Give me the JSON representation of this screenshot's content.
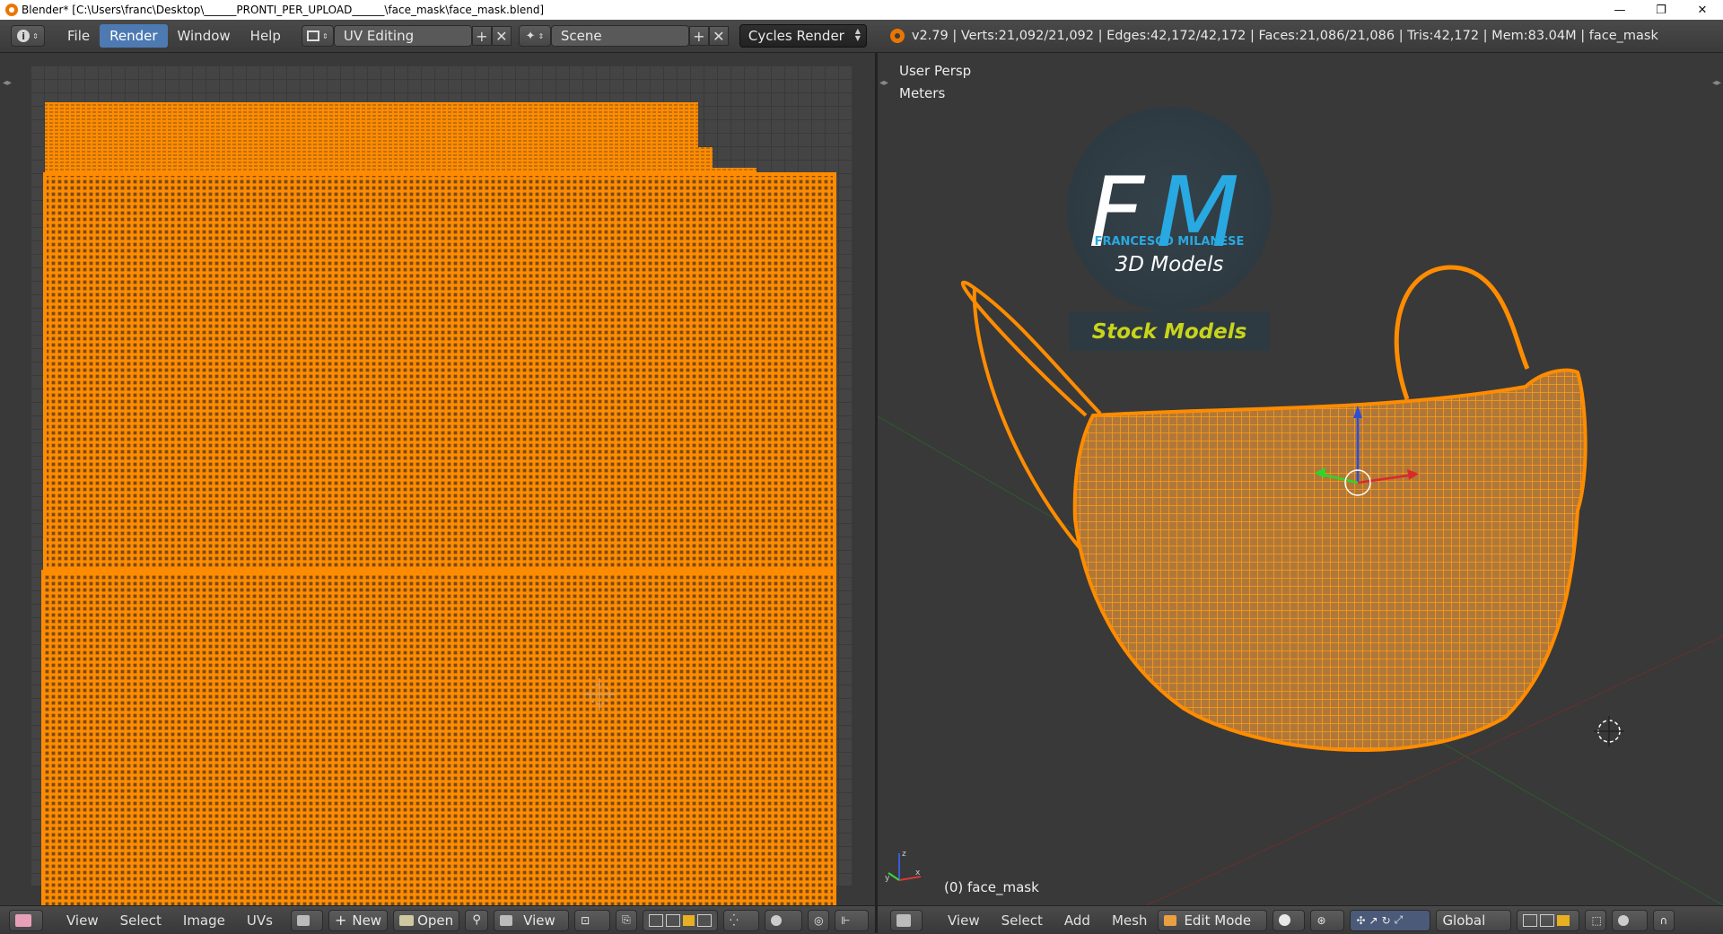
{
  "window": {
    "title": "Blender* [C:\\Users\\franc\\Desktop\\______PRONTI_PER_UPLOAD______\\face_mask\\face_mask.blend]",
    "minimize": "—",
    "maximize": "❐",
    "close": "✕"
  },
  "topbar": {
    "info_icon": "info-icon",
    "menus": [
      "File",
      "Render",
      "Window",
      "Help"
    ],
    "layout": "UV Editing",
    "scene": "Scene",
    "engine": "Cycles Render",
    "stats": "v2.79 | Verts:21,092/21,092 | Edges:42,172/42,172 | Faces:21,086/21,086 | Tris:42,172 | Mem:83.04M | face_mask"
  },
  "uv_editor": {
    "menus": [
      "View",
      "Select",
      "Image",
      "UVs"
    ],
    "new_label": "New",
    "open_label": "Open",
    "view_label": "View"
  },
  "viewport": {
    "view_name": "User Persp",
    "units": "Meters",
    "object_label": "(0) face_mask",
    "watermark": {
      "monogram": "FM",
      "author": "FRANCESCO MILANESE",
      "tagline": "3D Models",
      "banner": "Stock Models"
    },
    "menus": [
      "View",
      "Select",
      "Add",
      "Mesh"
    ],
    "mode": "Edit Mode",
    "orientation": "Global"
  },
  "colors": {
    "accent": "#ff8c00",
    "menu_active": "#4e7ab3",
    "logo_blue": "#29a9e1",
    "banner_text": "#c8d41a"
  }
}
